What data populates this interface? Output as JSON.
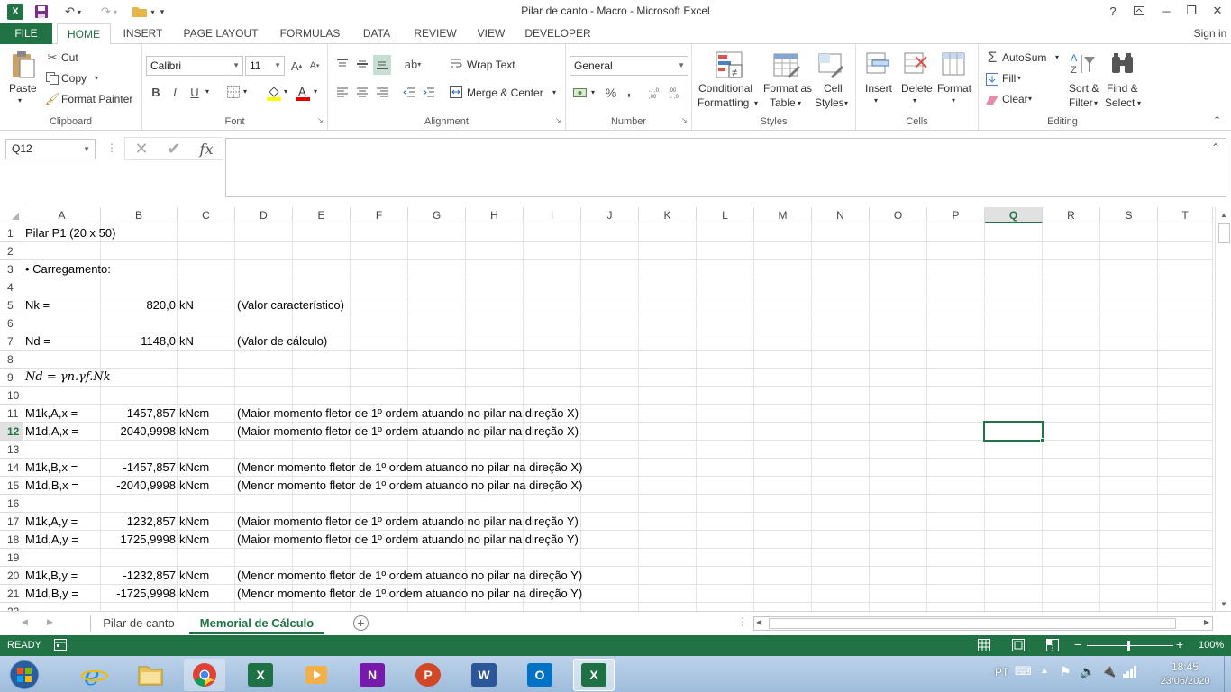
{
  "window": {
    "title": "Pilar de canto - Macro - Microsoft Excel",
    "help": "?",
    "minimize": "─",
    "restore": "❐",
    "close": "✕"
  },
  "tabs": [
    {
      "label": "FILE"
    },
    {
      "label": "HOME"
    },
    {
      "label": "INSERT"
    },
    {
      "label": "PAGE LAYOUT"
    },
    {
      "label": "FORMULAS"
    },
    {
      "label": "DATA"
    },
    {
      "label": "REVIEW"
    },
    {
      "label": "VIEW"
    },
    {
      "label": "DEVELOPER"
    }
  ],
  "signin": "Sign in",
  "ribbon": {
    "clipboard": {
      "label": "Clipboard",
      "paste": "Paste",
      "cut": "Cut",
      "copy": "Copy",
      "format_painter": "Format Painter"
    },
    "font": {
      "label": "Font",
      "name": "Calibri",
      "size": "11",
      "bold": "B",
      "italic": "I",
      "underline": "U"
    },
    "alignment": {
      "label": "Alignment",
      "wrap": "Wrap Text",
      "merge": "Merge & Center"
    },
    "number": {
      "label": "Number",
      "format": "General",
      "percent": "%",
      "comma": ","
    },
    "styles": {
      "label": "Styles",
      "conditional_1": "Conditional",
      "conditional_2": "Formatting",
      "format_table_1": "Format as",
      "format_table_2": "Table",
      "cell_styles_1": "Cell",
      "cell_styles_2": "Styles"
    },
    "cells": {
      "label": "Cells",
      "insert": "Insert",
      "delete": "Delete",
      "format": "Format"
    },
    "editing": {
      "label": "Editing",
      "autosum": "AutoSum",
      "fill": "Fill",
      "clear": "Clear",
      "sort_1": "Sort &",
      "sort_2": "Filter",
      "find_1": "Find &",
      "find_2": "Select"
    }
  },
  "formula_bar": {
    "name_box": "Q12",
    "fx": "fx",
    "value": ""
  },
  "columns": [
    "A",
    "B",
    "C",
    "D",
    "E",
    "F",
    "G",
    "H",
    "I",
    "J",
    "K",
    "L",
    "M",
    "N",
    "O",
    "P",
    "Q",
    "R",
    "S",
    "T"
  ],
  "selected_column": "Q",
  "selected_row": "12",
  "rows": [
    "1",
    "2",
    "3",
    "4",
    "5",
    "6",
    "7",
    "8",
    "9",
    "10",
    "11",
    "12",
    "13",
    "14",
    "15",
    "16",
    "17",
    "18",
    "19",
    "20",
    "21",
    "22"
  ],
  "cells": {
    "r1a": "Pilar P1 (20 x 50)",
    "r3a": "• Carregamento:",
    "r5a": "Nk =",
    "r5b": "820,0",
    "r5c": "kN",
    "r5d": "(Valor característico)",
    "r7a": "Nd =",
    "r7b": "1148,0",
    "r7c": "kN",
    "r7d": "(Valor de cálculo)",
    "r9a": "Nd = γn.γf.Nk",
    "r11a": "M1k,A,x =",
    "r11b": "1457,857",
    "r11c": "kNcm",
    "r11d": "(Maior momento fletor de 1º ordem atuando no pilar na direção X)",
    "r12a": "M1d,A,x =",
    "r12b": "2040,9998",
    "r12c": "kNcm",
    "r12d": "(Maior momento fletor de 1º ordem atuando no pilar na direção X)",
    "r14a": "M1k,B,x =",
    "r14b": "-1457,857",
    "r14c": "kNcm",
    "r14d": "(Menor momento fletor de 1º ordem atuando no pilar na direção X)",
    "r15a": "M1d,B,x =",
    "r15b": "-2040,9998",
    "r15c": "kNcm",
    "r15d": "(Menor momento fletor de 1º ordem atuando no pilar na direção X)",
    "r17a": "M1k,A,y =",
    "r17b": "1232,857",
    "r17c": "kNcm",
    "r17d": "(Maior momento fletor de 1º ordem atuando no pilar na direção Y)",
    "r18a": "M1d,A,y =",
    "r18b": "1725,9998",
    "r18c": "kNcm",
    "r18d": "(Maior momento fletor de 1º ordem atuando no pilar na direção Y)",
    "r20a": "M1k,B,y =",
    "r20b": "-1232,857",
    "r20c": "kNcm",
    "r20d": "(Menor momento fletor de 1º ordem atuando no pilar na direção Y)",
    "r21a": "M1d,B,y =",
    "r21b": "-1725,9998",
    "r21c": "kNcm",
    "r21d": "(Menor momento fletor de 1º ordem atuando no pilar na direção Y)"
  },
  "sheets": [
    {
      "label": "Pilar de canto"
    },
    {
      "label": "Memorial de Cálculo"
    }
  ],
  "active_sheet": "Memorial de Cálculo",
  "status": {
    "mode": "READY",
    "zoom": "100%",
    "zoom_minus": "−",
    "zoom_plus": "+"
  },
  "taskbar": {
    "lang": "PT",
    "time": "18:45",
    "date": "23/06/2020"
  },
  "colors": {
    "accent": "#217346"
  }
}
